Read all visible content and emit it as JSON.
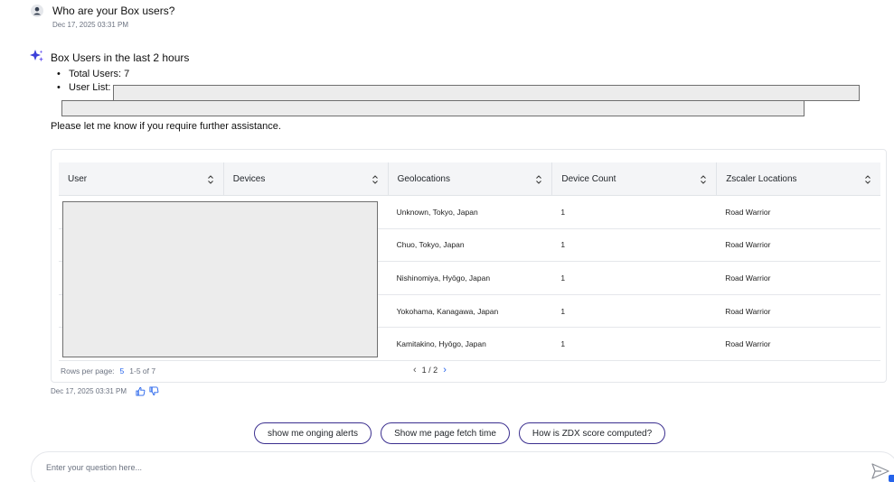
{
  "question": {
    "text": "Who are your Box users?",
    "timestamp": "Dec 17, 2025 03:31 PM",
    "icon": "user-icon"
  },
  "answer": {
    "icon": "sparkle-icon",
    "title": "Box Users in the last 2 hours",
    "bullets": [
      "Total Users: 7",
      "User List:"
    ],
    "help_text": "Please let me know if you require further assistance.",
    "timestamp": "Dec 17, 2025 03:31 PM"
  },
  "table": {
    "columns": [
      "User",
      "Devices",
      "Geolocations",
      "Device Count",
      "Zscaler Locations"
    ],
    "rows": [
      {
        "user": "",
        "devices": "",
        "geolocation": "Unknown, Tokyo, Japan",
        "device_count": "1",
        "zscaler_location": "Road Warrior"
      },
      {
        "user": "",
        "devices": "",
        "geolocation": "Chuo, Tokyo, Japan",
        "device_count": "1",
        "zscaler_location": "Road Warrior"
      },
      {
        "user": "",
        "devices": "",
        "geolocation": "Nishinomiya, Hyōgo, Japan",
        "device_count": "1",
        "zscaler_location": "Road Warrior"
      },
      {
        "user": "",
        "devices": "",
        "geolocation": "Yokohama, Kanagawa, Japan",
        "device_count": "1",
        "zscaler_location": "Road Warrior"
      },
      {
        "user": "",
        "devices": "",
        "geolocation": "Kamitakino, Hyōgo, Japan",
        "device_count": "1",
        "zscaler_location": "Road Warrior"
      }
    ],
    "rows_per_page_label": "Rows per page:",
    "rows_per_page_value": "5",
    "range_label": "1-5 of 7",
    "page_label": "1 / 2"
  },
  "suggestions": [
    "show me onging alerts",
    "Show me page fetch time",
    "How is ZDX score computed?"
  ],
  "input": {
    "placeholder": "Enter your question here...",
    "value": ""
  },
  "colors": {
    "accent": "#2563eb",
    "chip_border": "#3b2f8f",
    "redaction": "#ececec"
  }
}
